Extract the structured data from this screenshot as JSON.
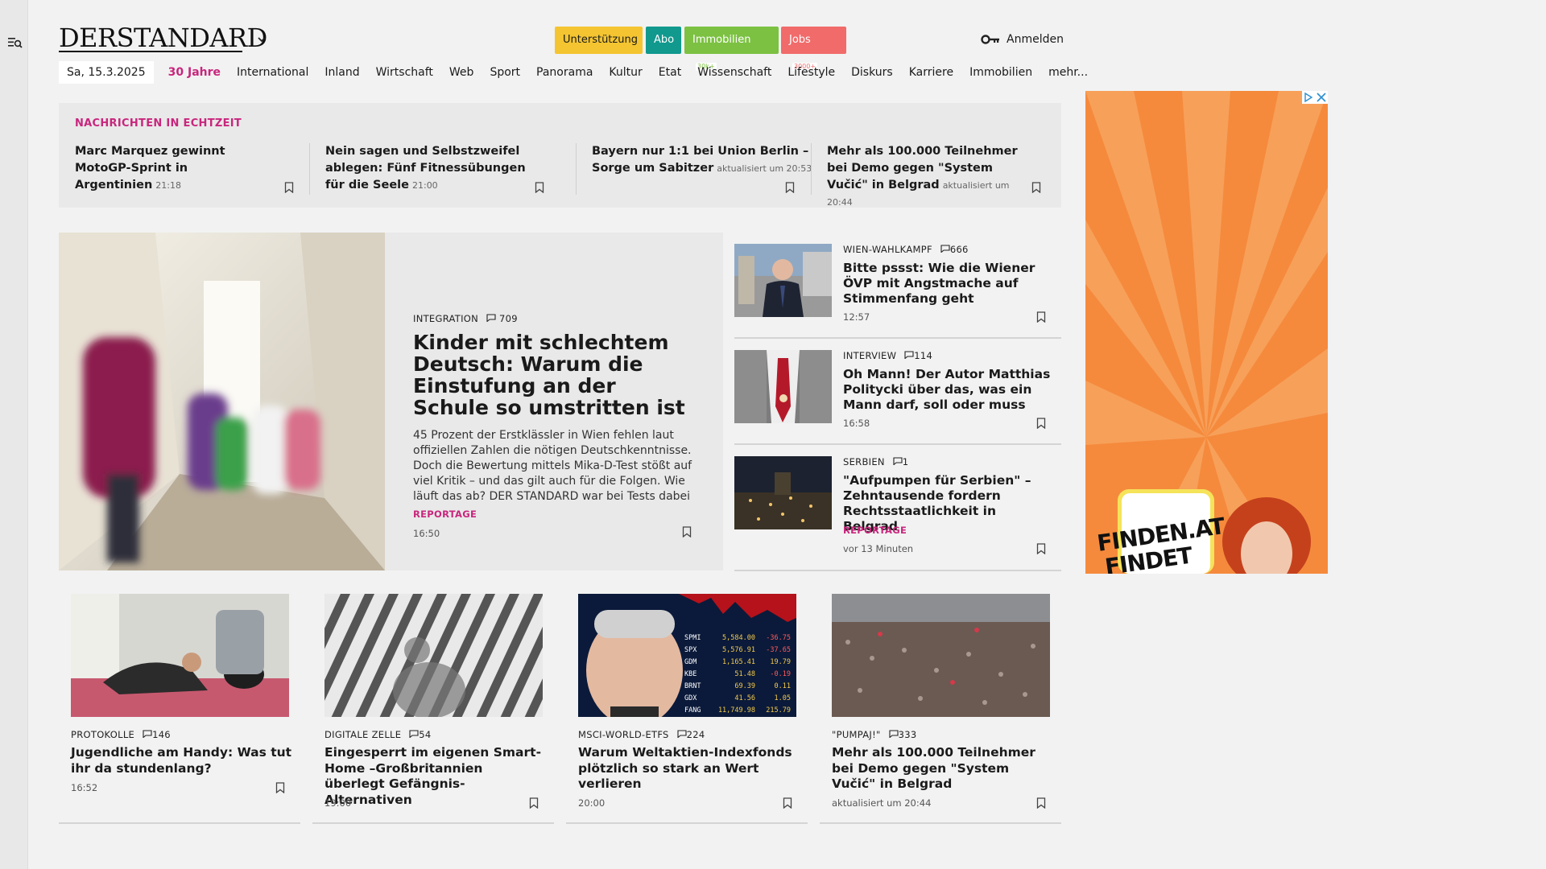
{
  "header": {
    "logo": "DERSTANDARD",
    "pills": [
      {
        "label": "Unterstützung",
        "tag": ""
      },
      {
        "label": "Abo",
        "tag": ""
      },
      {
        "label": "Immobilien",
        "tag": "30k+"
      },
      {
        "label": "Jobs",
        "tag": "3000+"
      }
    ],
    "login": "Anmelden"
  },
  "nav": {
    "date": "Sa, 15.3.2025",
    "items": [
      "30 Jahre",
      "International",
      "Inland",
      "Wirtschaft",
      "Web",
      "Sport",
      "Panorama",
      "Kultur",
      "Etat",
      "Wissenschaft",
      "Lifestyle",
      "Diskurs",
      "Karriere",
      "Immobilien",
      "mehr..."
    ]
  },
  "ticker": {
    "label": "NACHRICHTEN IN ECHTZEIT",
    "items": [
      {
        "title": "Marc Marquez gewinnt MotoGP-Sprint in Argentinien",
        "time": "21:18"
      },
      {
        "title": "Nein sagen und Selbstzweifel ablegen: Fünf Fitnessübungen für die Seele",
        "time": "21:00"
      },
      {
        "title": "Bayern nur 1:1 bei Union Berlin – Sorge um Sabitzer",
        "time": "aktualisiert um 20:53"
      },
      {
        "title": "Mehr als 100.000 Teilnehmer bei Demo gegen \"System Vučić\" in Belgrad",
        "time": "aktualisiert um 20:44"
      }
    ]
  },
  "hero": {
    "kicker": "INTEGRATION",
    "comments": "709",
    "title": "Kinder mit schlechtem Deutsch: Warum die Einstufung an der Schule so umstritten ist",
    "teaser": "45 Prozent der Erstklässler in Wien fehlen laut offiziellen Zahlen die nötigen Deutschkenntnisse. Doch die Bewertung mittels Mika-D-Test stößt auf viel Kritik – und das gilt auch für die Folgen. Wie läuft das ab? DER STANDARD war bei Tests dabei",
    "label": "REPORTAGE",
    "time": "16:50"
  },
  "side": [
    {
      "kicker": "WIEN-WAHLKAMPF",
      "comments": "666",
      "title": "Bitte pssst: Wie die Wiener ÖVP mit Angstmache auf Stimmenfang geht",
      "label": "",
      "time": "12:57"
    },
    {
      "kicker": "INTERVIEW",
      "comments": "114",
      "title": "Oh Mann! Der Autor Matthias Politycki über das, was ein Mann darf, soll oder muss",
      "label": "",
      "time": "16:58"
    },
    {
      "kicker": "SERBIEN",
      "comments": "1",
      "title": "\"Aufpumpen für Serbien\" – Zehntausende fordern Rechtsstaatlichkeit in Belgrad",
      "label": "REPORTAGE",
      "time": "vor 13 Minuten"
    }
  ],
  "cards": [
    {
      "kicker": "PROTOKOLLE",
      "comments": "146",
      "title": "Jugendliche am Handy: Was tut ihr da stundenlang?",
      "time": "16:52"
    },
    {
      "kicker": "DIGITALE ZELLE",
      "comments": "54",
      "title": "Eingesperrt im eigenen Smart-Home –Großbritannien überlegt Gefängnis-Alternativen",
      "time": "19:00"
    },
    {
      "kicker": "MSCI-WORLD-ETFS",
      "comments": "224",
      "title": "Warum Weltaktien-Indexfonds plötzlich so stark an Wert verlieren",
      "time": "20:00"
    },
    {
      "kicker": "\"PUMPAJ!\"",
      "comments": "333",
      "title": "Mehr als 100.000 Teilnehmer bei Demo gegen \"System Vučić\" in Belgrad",
      "time": "aktualisiert um 20:44"
    }
  ],
  "ticker_image": {
    "rows": [
      {
        "sym": "SPMI",
        "val": "5,584.00",
        "chg": "-36.75"
      },
      {
        "sym": "SPX",
        "val": "5,576.91",
        "chg": "-37.65"
      },
      {
        "sym": "GDM",
        "val": "1,165.41",
        "chg": "19.79"
      },
      {
        "sym": "KBE",
        "val": "51.48",
        "chg": "-0.19"
      },
      {
        "sym": "BRNT",
        "val": "69.39",
        "chg": "0.11"
      },
      {
        "sym": "GDX",
        "val": "41.56",
        "chg": "1.05"
      },
      {
        "sym": "FANG",
        "val": "11,749.98",
        "chg": "215.79"
      }
    ]
  },
  "ad": {
    "line1": "FINDEN.AT",
    "line2": "FINDET"
  },
  "colors": {
    "brand": "#c8267d",
    "support": "#f4c531",
    "abo": "#11998e",
    "immo": "#7cc142",
    "jobs": "#f16b6b",
    "ad": "#f58a3c"
  }
}
